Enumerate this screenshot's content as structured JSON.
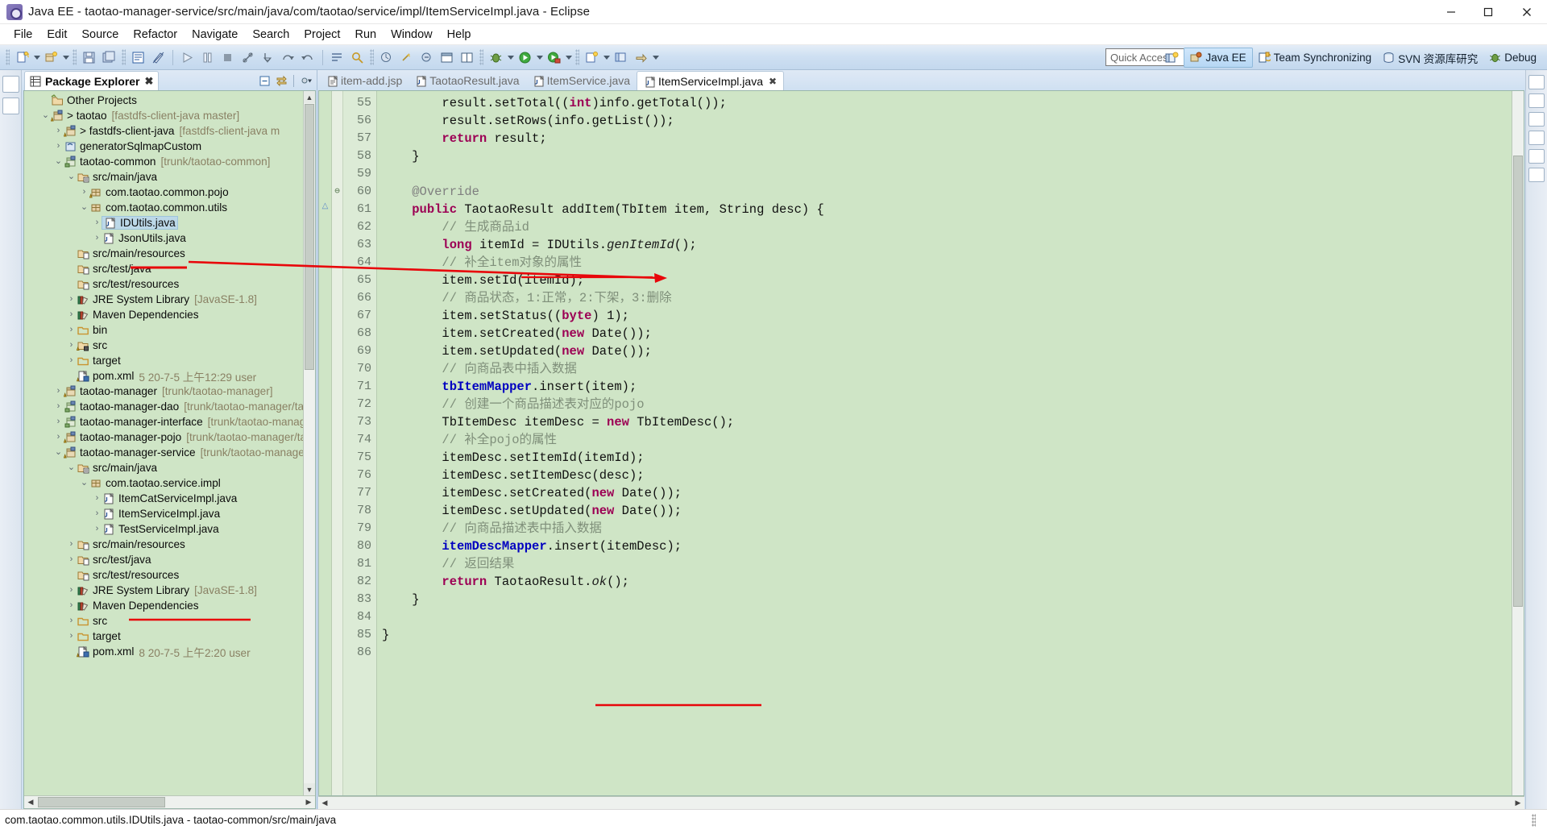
{
  "window": {
    "title": "Java EE - taotao-manager-service/src/main/java/com/taotao/service/impl/ItemServiceImpl.java - Eclipse",
    "app_icon": "eclipse-icon",
    "minimize_label": "─",
    "maximize_label": "❐",
    "close_label": "✕"
  },
  "menubar": {
    "items": [
      {
        "label": "File"
      },
      {
        "label": "Edit"
      },
      {
        "label": "Source"
      },
      {
        "label": "Refactor"
      },
      {
        "label": "Navigate"
      },
      {
        "label": "Search"
      },
      {
        "label": "Project"
      },
      {
        "label": "Run"
      },
      {
        "label": "Window"
      },
      {
        "label": "Help"
      }
    ]
  },
  "toolbar": {
    "quick_access_placeholder": "Quick Access",
    "quick_access_value": "",
    "open_perspective_icon": "open-perspective-icon",
    "perspectives": [
      {
        "label": "Java EE",
        "icon": "java-ee-perspective-icon",
        "active": true
      },
      {
        "label": "Team Synchronizing",
        "icon": "team-sync-perspective-icon",
        "active": false
      },
      {
        "label": "SVN 资源库研究",
        "icon": "svn-perspective-icon",
        "active": false
      },
      {
        "label": "Debug",
        "icon": "debug-perspective-icon",
        "active": false
      }
    ]
  },
  "explorer": {
    "tab_label": "Package Explorer",
    "tab_icon": "package-explorer-icon",
    "tab_close": "✖",
    "tools": [
      {
        "name": "collapse-all-icon",
        "glyph": "⊟"
      },
      {
        "name": "link-with-editor-icon",
        "glyph": "⇄"
      },
      {
        "name": "view-menu-icon",
        "glyph": "▽"
      }
    ],
    "tree": [
      {
        "indent": 1,
        "twisty": "",
        "icon": "other-projects-icon",
        "label": "Other Projects",
        "meta": ""
      },
      {
        "indent": 1,
        "twisty": "v",
        "icon": "java-project-warn-icon",
        "label": "> taotao",
        "meta": "[fastdfs-client-java master]"
      },
      {
        "indent": 2,
        "twisty": ">",
        "icon": "maven-project-warn-icon",
        "label": "> fastdfs-client-java",
        "meta": "[fastdfs-client-java m"
      },
      {
        "indent": 2,
        "twisty": ">",
        "icon": "project-icon",
        "label": "generatorSqlmapCustom",
        "meta": ""
      },
      {
        "indent": 2,
        "twisty": "v",
        "icon": "maven-project-icon",
        "label": "taotao-common",
        "meta": "[trunk/taotao-common]"
      },
      {
        "indent": 3,
        "twisty": "v",
        "icon": "source-folder-icon",
        "label": "src/main/java",
        "meta": ""
      },
      {
        "indent": 4,
        "twisty": ">",
        "icon": "package-warn-icon",
        "label": "com.taotao.common.pojo",
        "meta": ""
      },
      {
        "indent": 4,
        "twisty": "v",
        "icon": "package-icon",
        "label": "com.taotao.common.utils",
        "meta": ""
      },
      {
        "indent": 5,
        "twisty": ">",
        "icon": "java-file-icon",
        "label": "IDUtils.java",
        "meta": "",
        "selected": true
      },
      {
        "indent": 5,
        "twisty": ">",
        "icon": "java-file-icon",
        "label": "JsonUtils.java",
        "meta": ""
      },
      {
        "indent": 3,
        "twisty": "",
        "icon": "folder-src-icon",
        "label": "src/main/resources",
        "meta": ""
      },
      {
        "indent": 3,
        "twisty": "",
        "icon": "folder-src-icon",
        "label": "src/test/java",
        "meta": ""
      },
      {
        "indent": 3,
        "twisty": "",
        "icon": "folder-src-icon",
        "label": "src/test/resources",
        "meta": ""
      },
      {
        "indent": 3,
        "twisty": ">",
        "icon": "library-icon",
        "label": "JRE System Library",
        "meta": "[JavaSE-1.8]"
      },
      {
        "indent": 3,
        "twisty": ">",
        "icon": "library-icon",
        "label": "Maven Dependencies",
        "meta": ""
      },
      {
        "indent": 3,
        "twisty": ">",
        "icon": "folder-icon",
        "label": "bin",
        "meta": ""
      },
      {
        "indent": 3,
        "twisty": ">",
        "icon": "folder-warn-icon",
        "label": "src",
        "meta": ""
      },
      {
        "indent": 3,
        "twisty": ">",
        "icon": "folder-icon",
        "label": "target",
        "meta": ""
      },
      {
        "indent": 3,
        "twisty": "",
        "icon": "pom-xml-icon",
        "label": "pom.xml",
        "meta": "5  20-7-5 上午12:29  user"
      },
      {
        "indent": 2,
        "twisty": ">",
        "icon": "maven-project-warn-icon",
        "label": "taotao-manager",
        "meta": "[trunk/taotao-manager]"
      },
      {
        "indent": 2,
        "twisty": ">",
        "icon": "maven-project-icon",
        "label": "taotao-manager-dao",
        "meta": "[trunk/taotao-manager/taot"
      },
      {
        "indent": 2,
        "twisty": ">",
        "icon": "maven-project-icon",
        "label": "taotao-manager-interface",
        "meta": "[trunk/taotao-manager,"
      },
      {
        "indent": 2,
        "twisty": ">",
        "icon": "maven-project-warn-icon",
        "label": "taotao-manager-pojo",
        "meta": "[trunk/taotao-manager/tao"
      },
      {
        "indent": 2,
        "twisty": "v",
        "icon": "maven-project-warn-icon",
        "label": "taotao-manager-service",
        "meta": "[trunk/taotao-manager/t"
      },
      {
        "indent": 3,
        "twisty": "v",
        "icon": "source-folder-icon",
        "label": "src/main/java",
        "meta": ""
      },
      {
        "indent": 4,
        "twisty": "v",
        "icon": "package-icon",
        "label": "com.taotao.service.impl",
        "meta": ""
      },
      {
        "indent": 5,
        "twisty": ">",
        "icon": "java-file-icon",
        "label": "ItemCatServiceImpl.java",
        "meta": ""
      },
      {
        "indent": 5,
        "twisty": ">",
        "icon": "java-file-icon",
        "label": "ItemServiceImpl.java",
        "meta": "",
        "underline": true
      },
      {
        "indent": 5,
        "twisty": ">",
        "icon": "java-file-icon",
        "label": "TestServiceImpl.java",
        "meta": ""
      },
      {
        "indent": 3,
        "twisty": ">",
        "icon": "folder-src-icon",
        "label": "src/main/resources",
        "meta": ""
      },
      {
        "indent": 3,
        "twisty": ">",
        "icon": "folder-src-icon",
        "label": "src/test/java",
        "meta": ""
      },
      {
        "indent": 3,
        "twisty": "",
        "icon": "folder-src-icon",
        "label": "src/test/resources",
        "meta": ""
      },
      {
        "indent": 3,
        "twisty": ">",
        "icon": "library-icon",
        "label": "JRE System Library",
        "meta": "[JavaSE-1.8]"
      },
      {
        "indent": 3,
        "twisty": ">",
        "icon": "library-icon",
        "label": "Maven Dependencies",
        "meta": ""
      },
      {
        "indent": 3,
        "twisty": ">",
        "icon": "folder-icon",
        "label": "src",
        "meta": ""
      },
      {
        "indent": 3,
        "twisty": ">",
        "icon": "folder-icon",
        "label": "target",
        "meta": ""
      },
      {
        "indent": 3,
        "twisty": "",
        "icon": "pom-xml-icon",
        "label": "pom.xml",
        "meta": "8  20-7-5 上午2:20  user"
      }
    ]
  },
  "editor": {
    "tabs": [
      {
        "label": "item-add.jsp",
        "icon": "jsp-file-icon",
        "active": false
      },
      {
        "label": "TaotaoResult.java",
        "icon": "java-file-icon",
        "active": false
      },
      {
        "label": "ItemService.java",
        "icon": "java-file-icon",
        "active": false
      },
      {
        "label": "ItemServiceImpl.java",
        "icon": "java-file-icon",
        "active": true,
        "close": "✖"
      }
    ],
    "first_line_number": 55,
    "lines": [
      {
        "n": 55,
        "fold": "",
        "mark": "",
        "tokens": [
          {
            "t": "        result.setTotal((",
            "c": "plain"
          },
          {
            "t": "int",
            "c": "kw"
          },
          {
            "t": ")info.getTotal());",
            "c": "plain"
          }
        ]
      },
      {
        "n": 56,
        "fold": "",
        "mark": "",
        "tokens": [
          {
            "t": "        result.setRows(info.getList());",
            "c": "plain"
          }
        ]
      },
      {
        "n": 57,
        "fold": "",
        "mark": "",
        "tokens": [
          {
            "t": "        ",
            "c": "plain"
          },
          {
            "t": "return",
            "c": "kw"
          },
          {
            "t": " result;",
            "c": "plain"
          }
        ]
      },
      {
        "n": 58,
        "fold": "",
        "mark": "",
        "tokens": [
          {
            "t": "    }",
            "c": "plain"
          }
        ]
      },
      {
        "n": 59,
        "fold": "",
        "mark": "",
        "tokens": [
          {
            "t": "",
            "c": "plain"
          }
        ]
      },
      {
        "n": 60,
        "fold": "⊖",
        "mark": "",
        "tokens": [
          {
            "t": "    ",
            "c": "plain"
          },
          {
            "t": "@Override",
            "c": "anno"
          }
        ]
      },
      {
        "n": 61,
        "fold": "",
        "mark": "△",
        "tokens": [
          {
            "t": "    ",
            "c": "plain"
          },
          {
            "t": "public",
            "c": "kw"
          },
          {
            "t": " TaotaoResult addItem(TbItem item, String desc) {",
            "c": "plain"
          }
        ]
      },
      {
        "n": 62,
        "fold": "",
        "mark": "",
        "tokens": [
          {
            "t": "        // 生成商品id",
            "c": "cmt"
          }
        ]
      },
      {
        "n": 63,
        "fold": "",
        "mark": "",
        "tokens": [
          {
            "t": "        ",
            "c": "plain"
          },
          {
            "t": "long",
            "c": "kw"
          },
          {
            "t": " itemId = IDUtils.",
            "c": "plain"
          },
          {
            "t": "genItemId",
            "c": "mth"
          },
          {
            "t": "();",
            "c": "plain"
          }
        ]
      },
      {
        "n": 64,
        "fold": "",
        "mark": "",
        "tokens": [
          {
            "t": "        // 补全item对象的属性",
            "c": "cmt"
          }
        ]
      },
      {
        "n": 65,
        "fold": "",
        "mark": "",
        "tokens": [
          {
            "t": "        item.setId(itemId);",
            "c": "plain"
          }
        ]
      },
      {
        "n": 66,
        "fold": "",
        "mark": "",
        "tokens": [
          {
            "t": "        // 商品状态，1:正常，2:下架，3:删除",
            "c": "cmt"
          }
        ]
      },
      {
        "n": 67,
        "fold": "",
        "mark": "",
        "tokens": [
          {
            "t": "        item.setStatus((",
            "c": "plain"
          },
          {
            "t": "byte",
            "c": "kw"
          },
          {
            "t": ") 1);",
            "c": "plain"
          }
        ]
      },
      {
        "n": 68,
        "fold": "",
        "mark": "",
        "tokens": [
          {
            "t": "        item.setCreated(",
            "c": "plain"
          },
          {
            "t": "new",
            "c": "kw"
          },
          {
            "t": " Date());",
            "c": "plain"
          }
        ]
      },
      {
        "n": 69,
        "fold": "",
        "mark": "",
        "tokens": [
          {
            "t": "        item.setUpdated(",
            "c": "plain"
          },
          {
            "t": "new",
            "c": "kw"
          },
          {
            "t": " Date());",
            "c": "plain"
          }
        ]
      },
      {
        "n": 70,
        "fold": "",
        "mark": "",
        "tokens": [
          {
            "t": "        // 向商品表中插入数据",
            "c": "cmt"
          }
        ]
      },
      {
        "n": 71,
        "fold": "",
        "mark": "",
        "tokens": [
          {
            "t": "        ",
            "c": "plain"
          },
          {
            "t": "tbItemMapper",
            "c": "fld"
          },
          {
            "t": ".insert(item);",
            "c": "plain"
          }
        ]
      },
      {
        "n": 72,
        "fold": "",
        "mark": "",
        "tokens": [
          {
            "t": "        // 创建一个商品描述表对应的pojo",
            "c": "cmt"
          }
        ]
      },
      {
        "n": 73,
        "fold": "",
        "mark": "",
        "tokens": [
          {
            "t": "        TbItemDesc itemDesc = ",
            "c": "plain"
          },
          {
            "t": "new",
            "c": "kw"
          },
          {
            "t": " TbItemDesc();",
            "c": "plain"
          }
        ]
      },
      {
        "n": 74,
        "fold": "",
        "mark": "",
        "tokens": [
          {
            "t": "        // 补全pojo的属性",
            "c": "cmt"
          }
        ]
      },
      {
        "n": 75,
        "fold": "",
        "mark": "",
        "tokens": [
          {
            "t": "        itemDesc.setItemId(itemId);",
            "c": "plain"
          }
        ]
      },
      {
        "n": 76,
        "fold": "",
        "mark": "",
        "tokens": [
          {
            "t": "        itemDesc.setItemDesc(desc);",
            "c": "plain"
          }
        ]
      },
      {
        "n": 77,
        "fold": "",
        "mark": "",
        "tokens": [
          {
            "t": "        itemDesc.setCreated(",
            "c": "plain"
          },
          {
            "t": "new",
            "c": "kw"
          },
          {
            "t": " Date());",
            "c": "plain"
          }
        ]
      },
      {
        "n": 78,
        "fold": "",
        "mark": "",
        "tokens": [
          {
            "t": "        itemDesc.setUpdated(",
            "c": "plain"
          },
          {
            "t": "new",
            "c": "kw"
          },
          {
            "t": " Date());",
            "c": "plain"
          }
        ]
      },
      {
        "n": 79,
        "fold": "",
        "mark": "",
        "tokens": [
          {
            "t": "        // 向商品描述表中插入数据",
            "c": "cmt"
          }
        ]
      },
      {
        "n": 80,
        "fold": "",
        "mark": "",
        "tokens": [
          {
            "t": "        ",
            "c": "plain"
          },
          {
            "t": "itemDescMapper",
            "c": "fld"
          },
          {
            "t": ".insert(itemDesc);",
            "c": "plain"
          }
        ]
      },
      {
        "n": 81,
        "fold": "",
        "mark": "",
        "tokens": [
          {
            "t": "        // 返回结果",
            "c": "cmt"
          }
        ]
      },
      {
        "n": 82,
        "fold": "",
        "mark": "",
        "tokens": [
          {
            "t": "        ",
            "c": "plain"
          },
          {
            "t": "return",
            "c": "kw"
          },
          {
            "t": " TaotaoResult.",
            "c": "plain"
          },
          {
            "t": "ok",
            "c": "mth"
          },
          {
            "t": "();",
            "c": "plain"
          }
        ]
      },
      {
        "n": 83,
        "fold": "",
        "mark": "",
        "tokens": [
          {
            "t": "    }",
            "c": "plain"
          }
        ]
      },
      {
        "n": 84,
        "fold": "",
        "mark": "",
        "tokens": [
          {
            "t": "",
            "c": "plain"
          }
        ]
      },
      {
        "n": 85,
        "fold": "",
        "mark": "",
        "tokens": [
          {
            "t": "}",
            "c": "plain"
          }
        ]
      },
      {
        "n": 86,
        "fold": "",
        "mark": "",
        "tokens": [
          {
            "t": "",
            "c": "plain"
          }
        ]
      }
    ]
  },
  "statusbar": {
    "text": "com.taotao.common.utils.IDUtils.java - taotao-common/src/main/java"
  },
  "annotations": {
    "accent_color": "#e8060a",
    "arrow_name": "red-arrow-idutils-to-code",
    "underline_idutils": true,
    "underline_itemserviceimpl": true,
    "underline_taotaoresult_ok": true,
    "strikethrough_long_itemid": true
  },
  "colors": {
    "editor_background": "#cfe5c6",
    "tree_background": "#cfe5c6",
    "toolbar_background": "#cfe0f2",
    "selection": "#bcd8e8",
    "keyword": "#9c0054",
    "comment": "#7f8f7a",
    "field": "#0000c0"
  }
}
